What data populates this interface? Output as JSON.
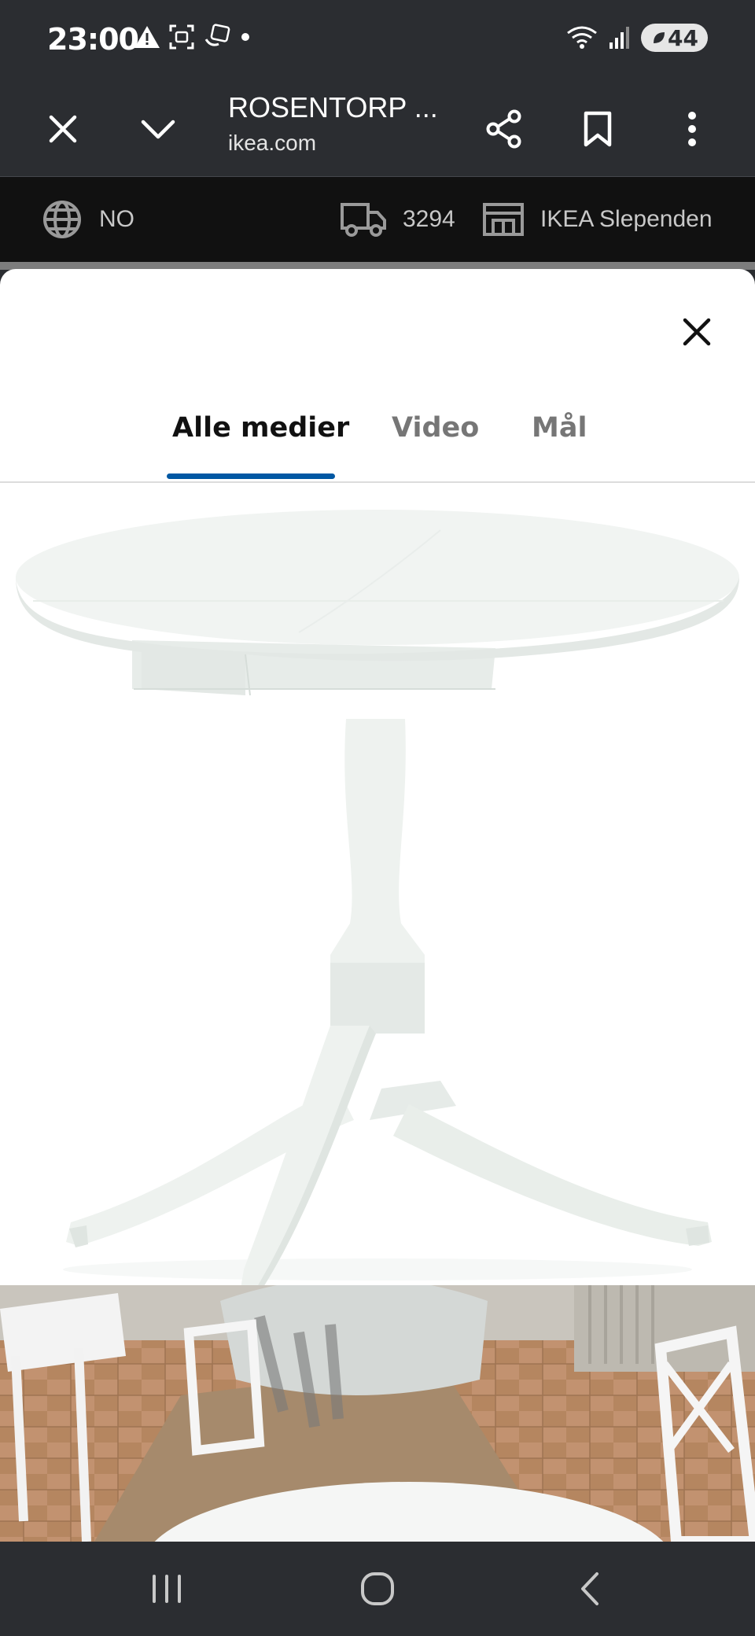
{
  "status_bar": {
    "time": "23:00",
    "battery": "44"
  },
  "browser": {
    "title": "ROSENTORP ...",
    "url": "ikea.com"
  },
  "ikea_header": {
    "language": "NO",
    "postcode": "3294",
    "store": "IKEA Slependen"
  },
  "media_viewer": {
    "tabs": [
      {
        "label": "Alle medier",
        "active": true
      },
      {
        "label": "Video",
        "active": false
      },
      {
        "label": "Mål",
        "active": false
      }
    ]
  },
  "colors": {
    "tab_indicator": "#0058a3",
    "chrome_background": "#2b2d31",
    "ikea_bar": "#111111"
  }
}
